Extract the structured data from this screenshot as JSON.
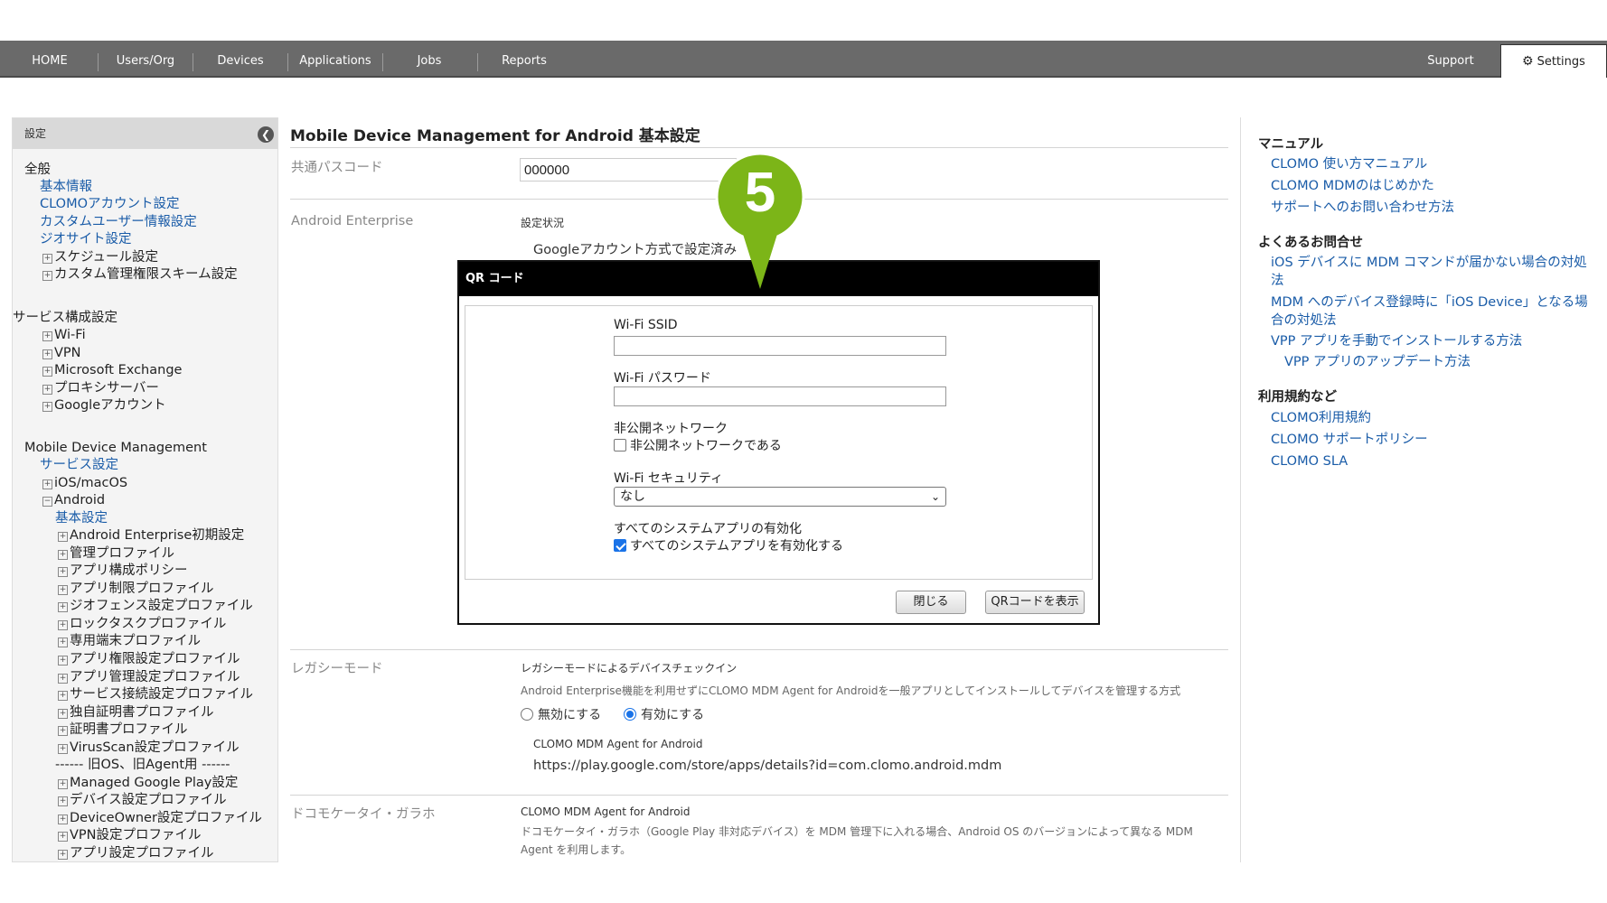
{
  "nav": {
    "items": [
      "HOME",
      "Users/Org",
      "Devices",
      "Applications",
      "Jobs",
      "Reports"
    ],
    "support": "Support",
    "settings": "Settings"
  },
  "sidebar": {
    "header": "設定",
    "sections": [
      {
        "title": "全般",
        "items": [
          "基本情報",
          "CLOMOアカウント設定",
          "カスタムユーザー情報設定",
          "ジオサイト設定",
          "スケジュール設定",
          "カスタム管理権限スキーム設定"
        ]
      },
      {
        "title": "サービス構成設定",
        "items": [
          "Wi-Fi",
          "VPN",
          "Microsoft Exchange",
          "プロキシサーバー",
          "Googleアカウント"
        ]
      },
      {
        "title": "Mobile Device Management",
        "items": [
          "サービス設定",
          "iOS/macOS",
          "Android",
          "基本設定",
          "Android Enterprise初期設定",
          "管理プロファイル",
          "アプリ構成ポリシー",
          "アプリ制限プロファイル",
          "ジオフェンス設定プロファイル",
          "ロックタスクプロファイル",
          "専用端末プロファイル",
          "アプリ権限設定プロファイル",
          "アプリ管理設定プロファイル",
          "サービス接続設定プロファイル",
          "独自証明書プロファイル",
          "証明書プロファイル",
          "VirusScan設定プロファイル",
          "------ 旧OS、旧Agent用 ------",
          "Managed Google Play設定",
          "デバイス設定プロファイル",
          "DeviceOwner設定プロファイル",
          "VPN設定プロファイル",
          "アプリ設定プロファイル"
        ]
      }
    ]
  },
  "main": {
    "title": "Mobile Device Management for Android 基本設定",
    "passcode_label": "共通パスコード",
    "passcode_value": "000000",
    "ae_label": "Android Enterprise",
    "ae_status_label": "設定状況",
    "ae_status_value": "Googleアカウント方式で設定済み",
    "legacy_label": "レガシーモード",
    "legacy_heading": "レガシーモードによるデバイスチェックイン",
    "legacy_desc": "Android Enterprise機能を利用せずにCLOMO MDM Agent for Androidを一般アプリとしてインストールしてデバイスを管理する方式",
    "radio_off": "無効にする",
    "radio_on": "有効にする",
    "agent_label": "CLOMO MDM Agent for Android",
    "agent_url": "https://play.google.com/store/apps/details?id=com.clomo.android.mdm",
    "docomo_label": "ドコモケータイ・ガラホ",
    "docomo_heading": "CLOMO MDM Agent for Android",
    "docomo_desc1": "ドコモケータイ・ガラホ（Google Play 非対応デバイス）を MDM 管理下に入れる場合、Android OS のバージョンによって異なる MDM",
    "docomo_desc2": "Agent を利用します。"
  },
  "modal": {
    "title": "QR コード",
    "ssid_label": "Wi-Fi SSID",
    "ssid_value": "",
    "password_label": "Wi-Fi パスワード",
    "password_value": "",
    "hidden_label": "非公開ネットワーク",
    "hidden_checkbox": "非公開ネットワークである",
    "hidden_checked": false,
    "security_label": "Wi-Fi セキュリティ",
    "security_value": "なし",
    "sysapps_label": "すべてのシステムアプリの有効化",
    "sysapps_checkbox": "すべてのシステムアプリを有効化する",
    "sysapps_checked": true,
    "close_button": "閉じる",
    "show_qr_button": "QRコードを表示"
  },
  "callout": {
    "number": "5",
    "color": "#7cb518"
  },
  "rightbar": {
    "manual_title": "マニュアル",
    "manual_links": [
      "CLOMO 使い方マニュアル",
      "CLOMO MDMのはじめかた",
      "サポートへのお問い合わせ方法"
    ],
    "faq_title": "よくあるお問合せ",
    "faq_links": [
      "iOS デバイスに MDM コマンドが届かない場合の対処法",
      "MDM へのデバイス登録時に「iOS Device」となる場合の対処法",
      "VPP アプリを手動でインストールする方法",
      "VPP アプリのアップデート方法"
    ],
    "terms_title": "利用規約など",
    "terms_links": [
      "CLOMO利用規約",
      "CLOMO サポートポリシー",
      "CLOMO SLA"
    ]
  }
}
